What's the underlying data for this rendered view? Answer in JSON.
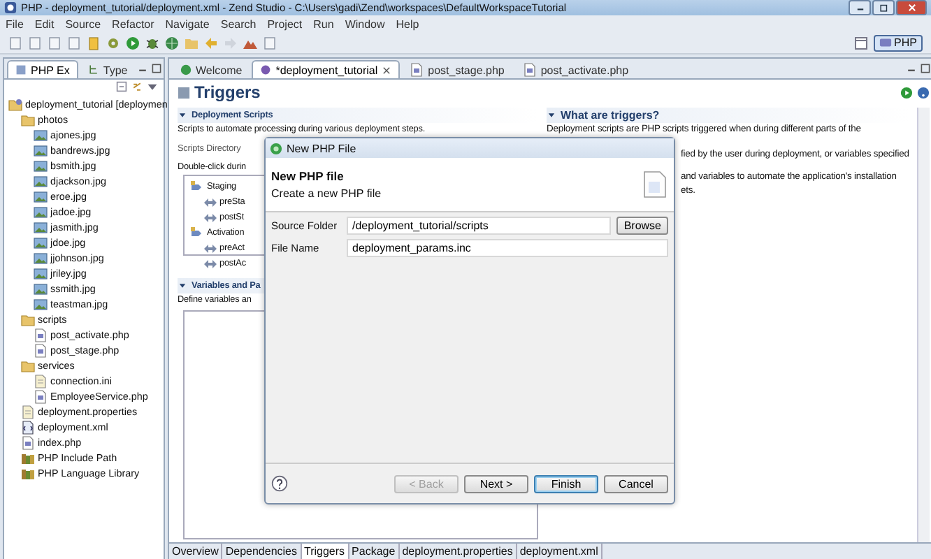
{
  "window": {
    "title": "PHP - deployment_tutorial/deployment.xml - Zend Studio - C:\\Users\\gadi\\Zend\\workspaces\\DefaultWorkspaceTutorial"
  },
  "menu": [
    "File",
    "Edit",
    "Source",
    "Refactor",
    "Navigate",
    "Search",
    "Project",
    "Run",
    "Window",
    "Help"
  ],
  "perspective": {
    "label": "PHP",
    "selected": true
  },
  "left_tabs": [
    {
      "label": "PHP Ex",
      "selected": true
    },
    {
      "label": "Type",
      "selected": false
    }
  ],
  "tree": [
    {
      "label": "deployment_tutorial [deploymen",
      "kind": "project",
      "children": [
        {
          "label": "photos",
          "kind": "folder",
          "children": [
            {
              "label": "ajones.jpg",
              "kind": "image"
            },
            {
              "label": "bandrews.jpg",
              "kind": "image"
            },
            {
              "label": "bsmith.jpg",
              "kind": "image"
            },
            {
              "label": "djackson.jpg",
              "kind": "image"
            },
            {
              "label": "eroe.jpg",
              "kind": "image"
            },
            {
              "label": "jadoe.jpg",
              "kind": "image"
            },
            {
              "label": "jasmith.jpg",
              "kind": "image"
            },
            {
              "label": "jdoe.jpg",
              "kind": "image"
            },
            {
              "label": "jjohnson.jpg",
              "kind": "image"
            },
            {
              "label": "jriley.jpg",
              "kind": "image"
            },
            {
              "label": "ssmith.jpg",
              "kind": "image"
            },
            {
              "label": "teastman.jpg",
              "kind": "image"
            }
          ]
        },
        {
          "label": "scripts",
          "kind": "folder",
          "children": [
            {
              "label": "post_activate.php",
              "kind": "php"
            },
            {
              "label": "post_stage.php",
              "kind": "php"
            }
          ]
        },
        {
          "label": "services",
          "kind": "folder",
          "children": [
            {
              "label": "connection.ini",
              "kind": "file"
            },
            {
              "label": "EmployeeService.php",
              "kind": "php"
            }
          ]
        },
        {
          "label": "deployment.properties",
          "kind": "file"
        },
        {
          "label": "deployment.xml",
          "kind": "xml"
        },
        {
          "label": "index.php",
          "kind": "php"
        },
        {
          "label": "PHP Include Path",
          "kind": "library"
        },
        {
          "label": "PHP Language Library",
          "kind": "library"
        }
      ]
    }
  ],
  "editor_tabs": [
    {
      "label": "Welcome",
      "selected": false
    },
    {
      "label": "*deployment_tutorial",
      "selected": true
    },
    {
      "label": "post_stage.php",
      "selected": false
    },
    {
      "label": "post_activate.php",
      "selected": false
    }
  ],
  "page": {
    "title": "Triggers",
    "deployment_scripts": {
      "title": "Deployment Scripts",
      "description": "Scripts to automate processing during various deployment steps.",
      "directory_label": "Scripts Directory",
      "hint": "Double-click durin",
      "items": [
        {
          "label": "Staging",
          "children": [
            {
              "label": "preSta"
            },
            {
              "label": "postSt"
            }
          ]
        },
        {
          "label": "Activation",
          "children": [
            {
              "label": "preAct"
            },
            {
              "label": "postAc"
            }
          ]
        }
      ]
    },
    "variables": {
      "title": "Variables and Pa",
      "description": "Define variables an"
    },
    "help": {
      "title": "What are triggers?",
      "lines": [
        {
          "text": "Deployment scripts are PHP scripts triggered when during different parts of the",
          "kind": "full"
        },
        {
          "text": "fied by the user during deployment, or variables specified",
          "kind": "cut"
        },
        {
          "text": "and variables to automate the application's installation",
          "kind": "cut"
        },
        {
          "text": "ets.",
          "kind": "cut"
        }
      ]
    }
  },
  "bottom_tabs": [
    {
      "label": "Overview",
      "selected": false
    },
    {
      "label": "Dependencies",
      "selected": false
    },
    {
      "label": "Triggers",
      "selected": true
    },
    {
      "label": "Package",
      "selected": false
    },
    {
      "label": "deployment.properties",
      "selected": false
    },
    {
      "label": "deployment.xml",
      "selected": false
    }
  ],
  "dialog": {
    "title": "New PHP File",
    "heading": "New PHP file",
    "description": "Create a new PHP file",
    "fields": [
      {
        "label": "Source Folder",
        "value": "/deployment_tutorial/scripts",
        "button": "Browse"
      },
      {
        "label": "File Name",
        "value": "deployment_params.inc"
      }
    ],
    "buttons": [
      {
        "label": "< Back",
        "disabled": true,
        "focused": false
      },
      {
        "label": "Next >",
        "disabled": false,
        "focused": false
      },
      {
        "label": "Finish",
        "disabled": false,
        "focused": true
      },
      {
        "label": "Cancel",
        "disabled": false,
        "focused": false
      }
    ]
  }
}
